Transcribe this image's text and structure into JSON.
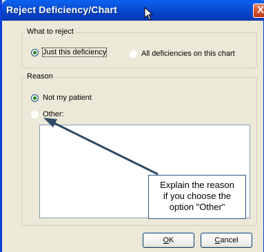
{
  "window": {
    "title": "Reject Deficiency/Chart",
    "close_glyph": "X"
  },
  "what_to_reject": {
    "legend": "What to reject",
    "options": [
      {
        "label": "Just this deficiency",
        "checked": true
      },
      {
        "label": "All deficiencies on this chart",
        "checked": false
      }
    ]
  },
  "reason": {
    "legend": "Reason",
    "options": [
      {
        "label": "Not my patient",
        "checked": true
      },
      {
        "label": "Other:",
        "checked": false
      }
    ],
    "other_text_value": ""
  },
  "annotation": {
    "line1": "Explain the reason",
    "line2": "if you choose the",
    "line3": "option \"Other\""
  },
  "buttons": {
    "ok_mnemonic": "O",
    "ok_rest": "K",
    "cancel_mnemonic": "C",
    "cancel_rest": "ancel"
  },
  "colors": {
    "titlebar": "#0744c8",
    "dialog_bg": "#ece9d8",
    "arrow": "#2e4a64"
  }
}
